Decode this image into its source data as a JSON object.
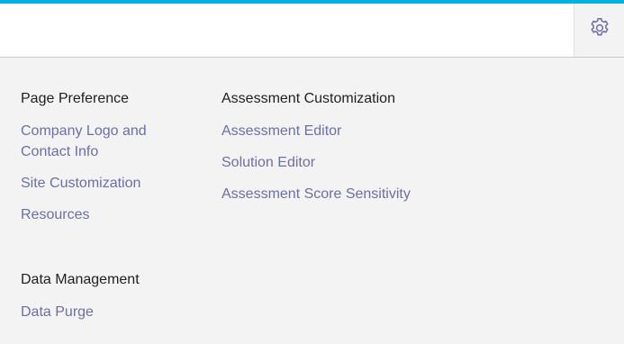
{
  "colors": {
    "accent": "#00b2e3",
    "link": "#6d6fa6",
    "heading": "#1f1f1f",
    "panel_bg": "#f3f3f3"
  },
  "header": {
    "settings_icon": "gear-icon"
  },
  "menu": {
    "page_preference": {
      "title": "Page Preference",
      "items": [
        "Company Logo and Contact Info",
        "Site Customization",
        "Resources"
      ]
    },
    "assessment_customization": {
      "title": "Assessment Customization",
      "items": [
        "Assessment Editor",
        "Solution Editor",
        "Assessment Score Sensitivity"
      ]
    },
    "data_management": {
      "title": "Data Management",
      "items": [
        "Data Purge"
      ]
    }
  }
}
